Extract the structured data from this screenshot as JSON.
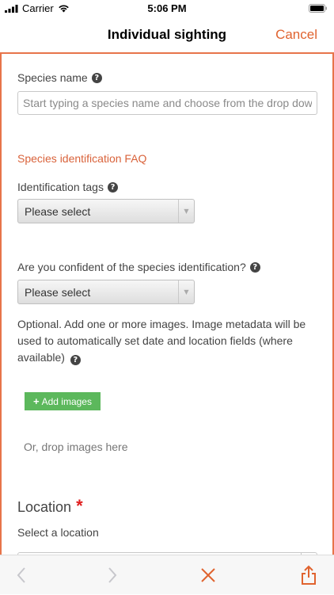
{
  "status_bar": {
    "carrier": "Carrier",
    "time": "5:06 PM"
  },
  "nav": {
    "title": "Individual sighting",
    "cancel_label": "Cancel"
  },
  "form": {
    "species_name_label": "Species name",
    "species_name_placeholder": "Start typing a species name and choose from the drop down",
    "species_name_value": "",
    "faq_link": "Species identification FAQ",
    "identification_tags_label": "Identification tags",
    "identification_tags_selected": "Please select",
    "confident_label": "Are you confident of the species identification?",
    "confident_selected": "Please select",
    "optional_text": "Optional. Add one or more images. Image metadata will be used to automatically set date and location fields (where available)",
    "add_images_label": "Add images",
    "drop_images_text": "Or, drop images here",
    "location_heading": "Location",
    "required_marker": "*",
    "select_location_label": "Select a location"
  },
  "colors": {
    "accent": "#e0632f",
    "link": "#d9623a",
    "success": "#5cb85c",
    "required": "#e01e1e"
  },
  "icons": [
    "wifi-icon",
    "battery-icon",
    "help-icon",
    "plus-icon",
    "back-arrow-icon",
    "forward-arrow-icon",
    "close-icon",
    "share-icon"
  ]
}
